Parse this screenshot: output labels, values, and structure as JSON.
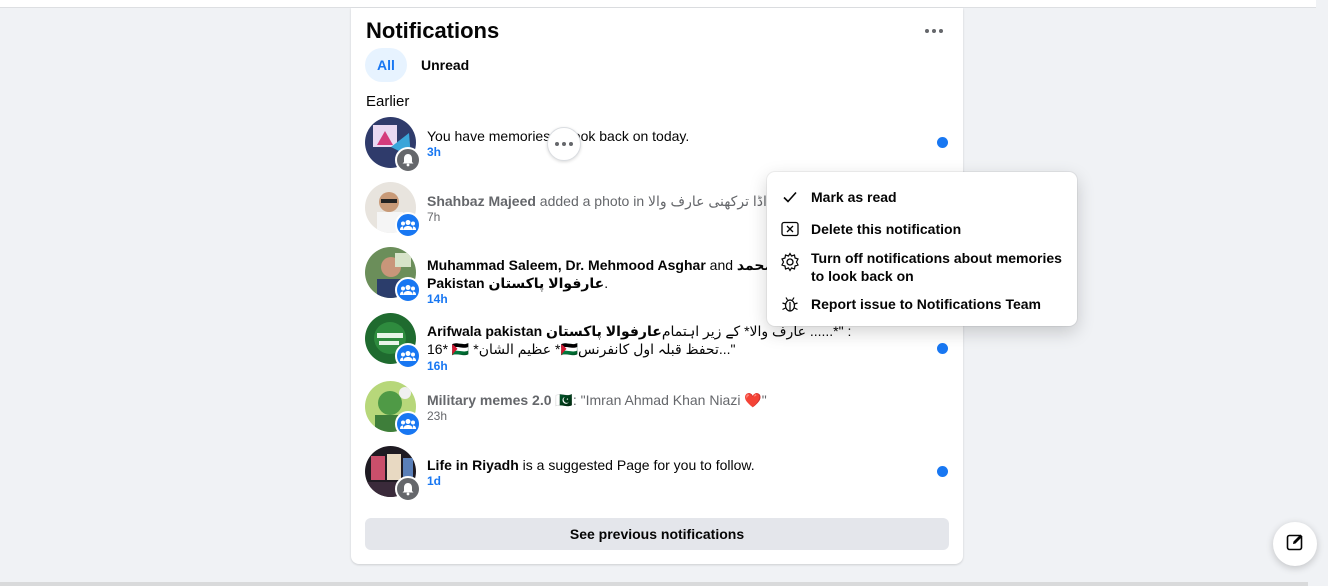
{
  "panel": {
    "title": "Notifications",
    "tabs": [
      {
        "label": "All",
        "active": true
      },
      {
        "label": "Unread",
        "active": false
      }
    ],
    "section_label": "Earlier",
    "see_previous_label": "See previous notifications"
  },
  "notifications": [
    {
      "text_pre": "You have memories to look back on today.",
      "actor": "",
      "text_post": "",
      "time": "3h",
      "unread": true,
      "badge_icon": "bell-icon"
    },
    {
      "actor": "Shahbaz Majeed",
      "text_pre": "",
      "text_post": " added a photo in اڈا ترکھنی عارف والا Ad",
      "time": "7h",
      "unread": false,
      "badge_icon": "group-icon"
    },
    {
      "actor": "Muhammad Saleem, Dr. Mehmood Asghar",
      "text_pre": "",
      "text_post": " and ",
      "actor2": "مد محمد",
      "line2_actor": "Pakistan عارفوالا پاکستان",
      "line2_post": ".",
      "time": "14h",
      "unread": true,
      "badge_icon": "group-icon"
    },
    {
      "actor": "Arifwala pakistan عارفوالا پاکستان",
      "text_post": ": \"*...... عارف والا* کے زیر اہتمام",
      "line2": "16* 🇵🇸 *عظیم الشان *🇵🇸تحفظ قبلہ اول کانفرنس...\"",
      "time": "16h",
      "unread": true,
      "badge_icon": "group-icon"
    },
    {
      "actor": "Military memes 2.0 🇵🇰",
      "text_post": ": \"Imran Ahmad Khan Niazi ❤️\"",
      "time": "23h",
      "unread": false,
      "badge_icon": "group-icon"
    },
    {
      "actor": "Life in Riyadh",
      "text_post": " is a suggested Page for you to follow.",
      "time": "1d",
      "unread": true,
      "badge_icon": "bell-icon"
    }
  ],
  "menu": {
    "items": [
      {
        "label": "Mark as read",
        "icon": "checkmark-icon"
      },
      {
        "label": "Delete this notification",
        "icon": "delete-box-icon"
      },
      {
        "label": "Turn off notifications about memories to look back on",
        "icon": "gear-icon"
      },
      {
        "label": "Report issue to Notifications Team",
        "icon": "bug-icon"
      }
    ]
  },
  "colors": {
    "accent": "#1877f2",
    "tab_active_bg": "#e7f3ff",
    "secondary_text": "#65676b",
    "page_bg": "#f0f2f5"
  }
}
